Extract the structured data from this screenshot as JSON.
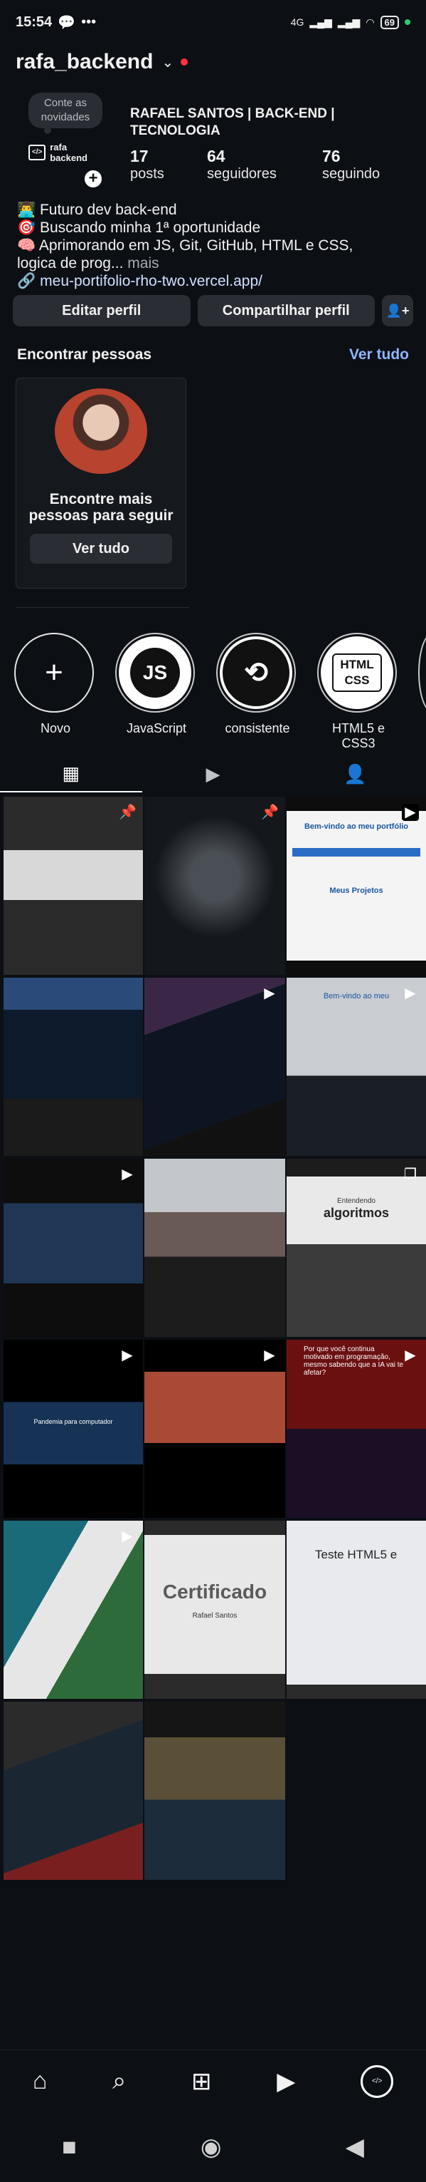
{
  "status_bar": {
    "time": "15:54",
    "signal": "4G",
    "battery": "69"
  },
  "header": {
    "username": "rafa_backend"
  },
  "profile": {
    "note": "Conte as novidades",
    "avatar_text": "rafa backend",
    "full_name": "RAFAEL SANTOS | BACK-END | TECNOLOGIA",
    "stats": [
      {
        "value": "17",
        "label": "posts"
      },
      {
        "value": "64",
        "label": "seguidores"
      },
      {
        "value": "76",
        "label": "seguindo"
      }
    ],
    "bio": [
      "👨‍💻 Futuro dev back-end",
      "🎯 Buscando minha 1ª oportunidade",
      "🧠 Aprimorando em JS, Git, GitHub, HTML e CSS,",
      "logica de prog..."
    ],
    "bio_more": "mais",
    "link": "meu-portifolio-rho-two.vercel.app/"
  },
  "buttons": {
    "edit": "Editar perfil",
    "share": "Compartilhar perfil"
  },
  "find_people": {
    "title": "Encontrar pessoas",
    "see_all": "Ver tudo",
    "card_text": "Encontre mais pessoas para seguir",
    "card_button": "Ver tudo"
  },
  "highlights": [
    {
      "label": "Novo"
    },
    {
      "label": "JavaScript",
      "art": "JS"
    },
    {
      "label": "consistente",
      "art": "⟲"
    },
    {
      "label": "HTML5 e CSS3",
      "art": "HTML CSS"
    }
  ],
  "grid": {
    "captions": {
      "post3": "Bem-vindo ao meu portfólio",
      "post3_sub": "Meus Projetos",
      "post6": "Bem-vindo ao meu",
      "post9": "algoritmos",
      "post9_sub": "Entendendo",
      "post10": "Pandemia para computador",
      "post12": "Por que você continua motivado em programação, mesmo sabendo que a IA vai te afetar?",
      "post14": "Certificado",
      "post14_sub": "Rafael Santos",
      "post15": "Teste HTML5 e"
    }
  }
}
